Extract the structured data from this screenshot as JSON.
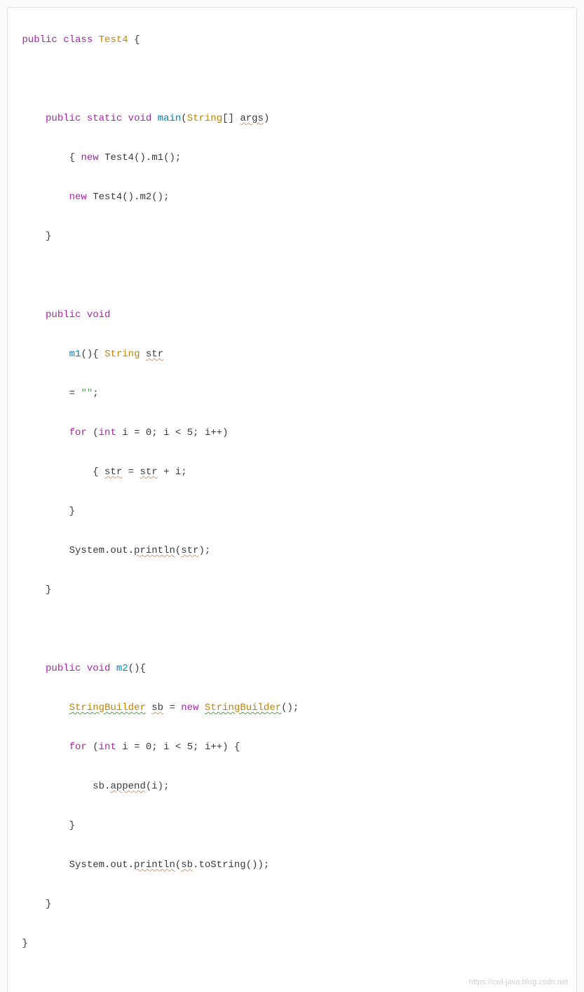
{
  "code": {
    "class_decl": {
      "public": "public",
      "class_kw": "class",
      "class_name": "Test4",
      "brace": "{"
    },
    "main": {
      "public": "public",
      "static": "static",
      "void": "void",
      "name": "main",
      "param_type": "String",
      "param_brackets": "[]",
      "param_name": "args",
      "body_open": "{",
      "new1": "new",
      "test4_1": "Test4",
      "call1": "().m1();",
      "new2": "new",
      "test4_2": "Test4",
      "call2": "().m2();",
      "body_close": "}"
    },
    "m1": {
      "public": "public",
      "void": "void",
      "name": "m1",
      "paren_brace": "(){",
      "str_type": "String",
      "str_var": "str",
      "eq": "=",
      "empty": "\"\"",
      "semi": ";",
      "for": "for",
      "int": "int",
      "i_init": "i = 0;",
      "cond": "i < 5;",
      "inc": "i++",
      "loop_open": "{",
      "str_assign_l": "str",
      "assign_eq": "=",
      "str_assign_r": "str",
      "plus_i": "+ i;",
      "loop_close": "}",
      "sysout": "System.out.",
      "println": "println",
      "str_arg": "str",
      "close_paren_semi": ");",
      "method_close": "}"
    },
    "m2": {
      "public": "public",
      "void": "void",
      "name": "m2",
      "paren_brace": "(){",
      "sb_type": "StringBuilder",
      "sb_var": "sb",
      "eq": "=",
      "new": "new",
      "sb_ctor": "StringBuilder",
      "ctor_close": "();",
      "for": "for",
      "int": "int",
      "i_init": "i = 0;",
      "cond": "i < 5;",
      "inc": "i++",
      "loop_open": ") {",
      "sb_call": "sb.",
      "append": "append",
      "append_arg": "(i);",
      "loop_close": "}",
      "sysout": "System.out.",
      "println": "println",
      "sb_arg": "sb",
      "tostring": ".toString",
      "close_paren_semi": "());",
      "method_close": "}"
    },
    "class_close": "}",
    "watermark": "https://cwl-java.blog.csdn.net"
  }
}
